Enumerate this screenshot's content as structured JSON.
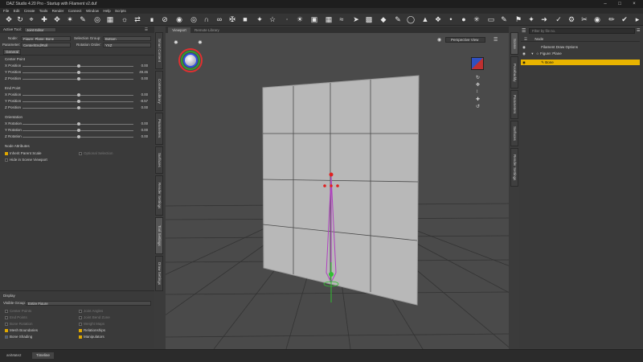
{
  "window": {
    "title": "DAZ Studio 4.20 Pro - Startup with Filament v2.duf"
  },
  "menu": [
    "File",
    "Edit",
    "Create",
    "Tools",
    "Render",
    "Connect",
    "Window",
    "Help",
    "Scripts"
  ],
  "left_panel": {
    "header": {
      "label": "Active Tool:",
      "tool": "Joint Editor"
    },
    "node_label": "Node:",
    "node_value": "Figure: Plane: Bone",
    "selection_group_label": "Selection Group:",
    "selection_group_value": "Bottom",
    "parameter_label": "Parameter:",
    "parameter_value": "Center/End/Roll",
    "rotation_order_label": "Rotation Order:",
    "rotation_order_value": "YXZ",
    "tab_general": "General",
    "center_point": {
      "title": "Center Point",
      "x_label": "X Position",
      "x_value": "0.00",
      "y_label": "Y Position",
      "y_value": "49.46",
      "z_label": "Z Position",
      "z_value": "0.00"
    },
    "end_point": {
      "title": "End Point",
      "x_label": "X Position",
      "x_value": "0.00",
      "y_label": "Y Position",
      "y_value": "-8.57",
      "z_label": "Z Position",
      "z_value": "0.00"
    },
    "orientation": {
      "title": "Orientation",
      "x_label": "X Rotation",
      "x_value": "0.00",
      "y_label": "Y Rotation",
      "y_value": "0.00",
      "z_label": "Z Rotation",
      "z_value": "0.00"
    },
    "node_attributes": {
      "title": "Node Attributes",
      "inherit": "Inherit Parent Scale",
      "hide": "Hide in Scene Viewport",
      "optional": "Optional Selection"
    },
    "display": {
      "title": "Display",
      "visible_group_label": "Visible Group:",
      "visible_group_value": "Entire Figure",
      "opts_left": [
        "Center Points",
        "End Points",
        "Bone Rotation",
        "Mesh Boundaries",
        "Bone Shading"
      ],
      "opts_right": [
        "Joint Angles",
        "Joint Bend Zone",
        "Weight Maps",
        "Relationships",
        "Manipulators"
      ]
    }
  },
  "side_tabs_left": [
    "Smart Content",
    "Content Library",
    "Parameters",
    "Surfaces",
    "Render Settings",
    "Tool Settings",
    "Draw Settings"
  ],
  "side_tabs_right": [
    "Scene",
    "Posebuddy",
    "Parameters",
    "Surfaces",
    "Render Settings"
  ],
  "viewport": {
    "tab": "Viewport",
    "tab2": "Remote Library",
    "camera": "Perspective View"
  },
  "scene": {
    "filter": "Filter by file no.",
    "col": "Node",
    "items": [
      "Filament Draw Options",
      "Figure: Plane",
      "Bone"
    ]
  },
  "bottom_tabs": [
    "aniMate2",
    "Timeline"
  ],
  "colors": {
    "accent": "#e8b400",
    "bone": "#b040c0",
    "joint_red": "#e02020"
  }
}
